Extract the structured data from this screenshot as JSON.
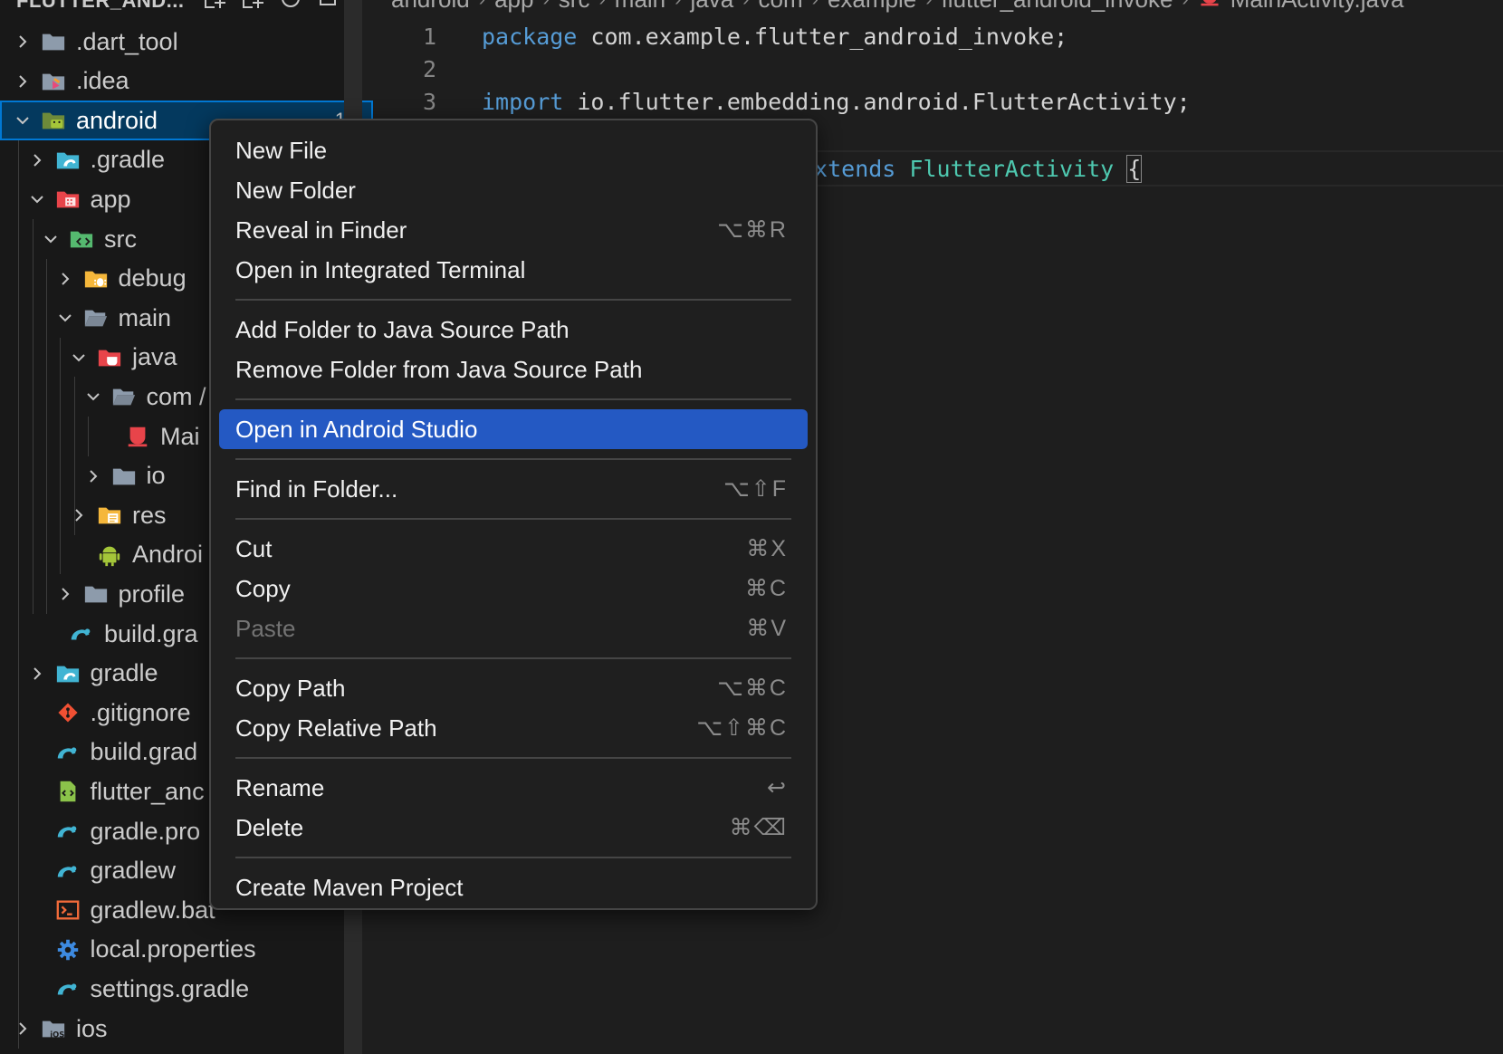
{
  "explorer": {
    "title": "FLUTTER_AND...",
    "header_icons": [
      "new-file-icon",
      "new-folder-icon",
      "refresh-icon",
      "collapse-all-icon"
    ],
    "tree": [
      {
        "label": ".dart_tool",
        "depth": 0,
        "chevron": "right",
        "icon": "folder-icon",
        "color": "#8d9bab"
      },
      {
        "label": ".idea",
        "depth": 0,
        "chevron": "right",
        "icon": "idea-folder-icon",
        "color": "#8d9bab"
      },
      {
        "label": "android",
        "depth": 0,
        "chevron": "down",
        "icon": "android-folder-icon",
        "color": "#a4c639",
        "selected": true,
        "badge": "1"
      },
      {
        "label": ".gradle",
        "depth": 1,
        "chevron": "right",
        "icon": "gradle-folder-icon",
        "color": "#41b4d3"
      },
      {
        "label": "app",
        "depth": 1,
        "chevron": "down",
        "icon": "app-folder-icon",
        "color": "#e8444a"
      },
      {
        "label": "src",
        "depth": 2,
        "chevron": "down",
        "icon": "src-folder-icon",
        "color": "#55b96f"
      },
      {
        "label": "debug",
        "depth": 3,
        "chevron": "right",
        "icon": "debug-folder-icon",
        "color": "#f5b73b"
      },
      {
        "label": "main",
        "depth": 3,
        "chevron": "down",
        "icon": "folder-open-icon",
        "color": "#8d9bab"
      },
      {
        "label": "java",
        "depth": 4,
        "chevron": "down",
        "icon": "java-folder-icon",
        "color": "#e8444a"
      },
      {
        "label": "com /",
        "depth": 5,
        "chevron": "down",
        "icon": "folder-open-icon",
        "color": "#8d9bab"
      },
      {
        "label": "Mai",
        "depth": 6,
        "chevron": "none",
        "icon": "java-file-icon",
        "color": "#e8444a"
      },
      {
        "label": "io",
        "depth": 5,
        "chevron": "right",
        "icon": "folder-icon",
        "color": "#8d9bab"
      },
      {
        "label": "res",
        "depth": 4,
        "chevron": "right",
        "icon": "res-folder-icon",
        "color": "#f5b73b"
      },
      {
        "label": "Androi",
        "depth": 4,
        "chevron": "none",
        "icon": "android-file-icon",
        "color": "#a4c639"
      },
      {
        "label": "profile",
        "depth": 3,
        "chevron": "right",
        "icon": "folder-icon",
        "color": "#8d9bab"
      },
      {
        "label": "build.gra",
        "depth": 2,
        "chevron": "none",
        "icon": "gradle-file-icon",
        "color": "#41b4d3"
      },
      {
        "label": "gradle",
        "depth": 1,
        "chevron": "right",
        "icon": "gradle-folder-icon",
        "color": "#41b4d3"
      },
      {
        "label": ".gitignore",
        "depth": 1,
        "chevron": "none",
        "icon": "git-icon",
        "color": "#f05033"
      },
      {
        "label": "build.grad",
        "depth": 1,
        "chevron": "none",
        "icon": "gradle-file-icon",
        "color": "#41b4d3"
      },
      {
        "label": "flutter_anc",
        "depth": 1,
        "chevron": "none",
        "icon": "xml-file-icon",
        "color": "#8bc34a"
      },
      {
        "label": "gradle.pro",
        "depth": 1,
        "chevron": "none",
        "icon": "gradle-file-icon",
        "color": "#41b4d3"
      },
      {
        "label": "gradlew",
        "depth": 1,
        "chevron": "none",
        "icon": "gradle-file-icon",
        "color": "#41b4d3"
      },
      {
        "label": "gradlew.bat",
        "depth": 1,
        "chevron": "none",
        "icon": "terminal-file-icon",
        "color": "#f26b3a"
      },
      {
        "label": "local.properties",
        "depth": 1,
        "chevron": "none",
        "icon": "gear-icon",
        "color": "#3d8ae0"
      },
      {
        "label": "settings.gradle",
        "depth": 1,
        "chevron": "none",
        "icon": "gradle-file-icon",
        "color": "#41b4d3"
      },
      {
        "label": "ios",
        "depth": 0,
        "chevron": "right",
        "icon": "ios-folder-icon",
        "color": "#8d9bab"
      }
    ]
  },
  "breadcrumb": {
    "segments": [
      "android",
      "app",
      "src",
      "main",
      "java",
      "com",
      "example",
      "flutter_android_invoke",
      "MainActivity.java"
    ],
    "file_icon": "java-file-icon"
  },
  "editor": {
    "lines": [
      {
        "num": "1",
        "tokens": [
          {
            "t": "package",
            "c": "kw"
          },
          {
            "t": " com.example.flutter_android_invoke;",
            "c": "txt"
          }
        ]
      },
      {
        "num": "2",
        "tokens": []
      },
      {
        "num": "3",
        "tokens": [
          {
            "t": "import",
            "c": "kw"
          },
          {
            "t": " io.flutter.embedding.android.FlutterActivity;",
            "c": "txt"
          }
        ]
      },
      {
        "num": "",
        "tokens": [
          {
            "t": "extends",
            "c": "kw"
          },
          {
            "t": " ",
            "c": "txt"
          },
          {
            "t": "FlutterActivity",
            "c": "typ"
          },
          {
            "t": " ",
            "c": "txt"
          },
          {
            "t": "{",
            "c": "brace"
          }
        ],
        "current": true
      }
    ]
  },
  "context_menu": {
    "items": [
      {
        "label": "New File",
        "shortcut": ""
      },
      {
        "label": "New Folder",
        "shortcut": ""
      },
      {
        "label": "Reveal in Finder",
        "shortcut": "⌥⌘R"
      },
      {
        "label": "Open in Integrated Terminal",
        "shortcut": ""
      },
      {
        "separator": true
      },
      {
        "label": "Add Folder to Java Source Path",
        "shortcut": ""
      },
      {
        "label": "Remove Folder from Java Source Path",
        "shortcut": ""
      },
      {
        "separator": true
      },
      {
        "label": "Open in Android Studio",
        "shortcut": "",
        "active": true
      },
      {
        "separator": true
      },
      {
        "label": "Find in Folder...",
        "shortcut": "⌥⇧F"
      },
      {
        "separator": true
      },
      {
        "label": "Cut",
        "shortcut": "⌘X"
      },
      {
        "label": "Copy",
        "shortcut": "⌘C"
      },
      {
        "label": "Paste",
        "shortcut": "⌘V",
        "disabled": true
      },
      {
        "separator": true
      },
      {
        "label": "Copy Path",
        "shortcut": "⌥⌘C"
      },
      {
        "label": "Copy Relative Path",
        "shortcut": "⌥⇧⌘C"
      },
      {
        "separator": true
      },
      {
        "label": "Rename",
        "shortcut": "↩"
      },
      {
        "label": "Delete",
        "shortcut": "⌘⌫"
      },
      {
        "separator": true
      },
      {
        "label": "Create Maven Project",
        "shortcut": ""
      }
    ]
  },
  "colors": {
    "selection": "#04395e",
    "menu_highlight": "#2459c3",
    "keyword": "#569cd6",
    "type": "#4ec9b0"
  }
}
